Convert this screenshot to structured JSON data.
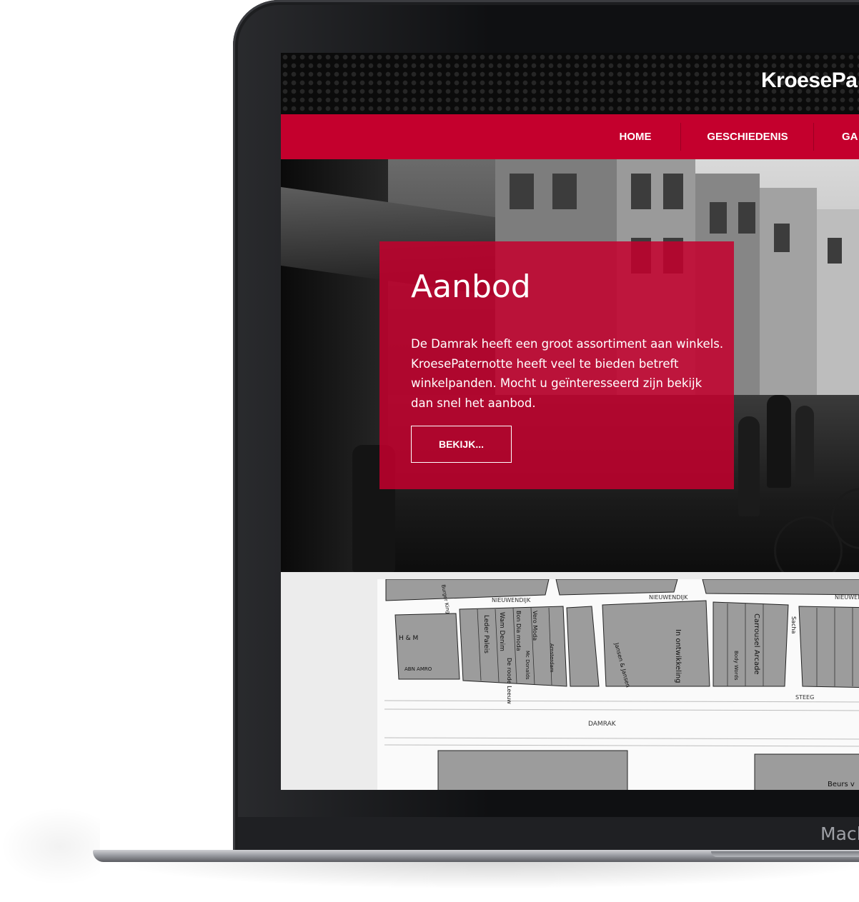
{
  "site": {
    "logo": "KroesePa",
    "nav": [
      {
        "label": "HOME"
      },
      {
        "label": "GESCHIEDENIS"
      },
      {
        "label": "GA"
      }
    ]
  },
  "hero": {
    "title": "Aanbod",
    "text": "De Damrak heeft een groot assortiment aan winkels. KroesePaternotte heeft veel te bieden betreft winkelpanden. Mocht u geïnteresseerd zijn bekijk dan snel het aanbod.",
    "button_label": "BEKIJK..."
  },
  "map": {
    "street_labels": [
      "NIEUWENDIJK",
      "NIEUWENDIJK",
      "NIEUWENDIJK",
      "DAMRAK",
      "STEEG"
    ],
    "shop_labels": [
      "H & M",
      "ABN AMRO",
      "Leder Paleis",
      "Wam Denim",
      "Bon Dia moda",
      "Vero Moda",
      "Amsterdam",
      "Mc Donalds",
      "De roode Leeuw",
      "In ontwikkeling",
      "Carrousel Arcade",
      "Body Words",
      "Jansen & Jansen",
      "Burger King",
      "Sacha",
      "Beurs v"
    ]
  },
  "device": {
    "label": "Macl"
  }
}
